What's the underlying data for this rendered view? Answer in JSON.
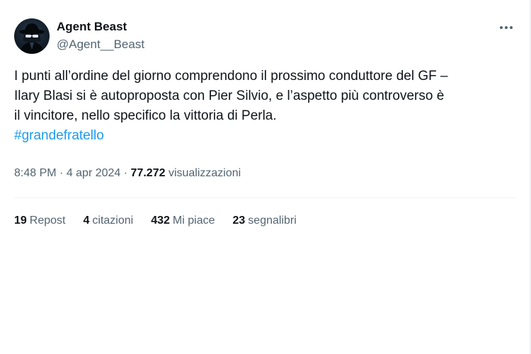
{
  "author": {
    "display_name": "Agent Beast",
    "handle": "@Agent__Beast",
    "avatar_icon": "hooded-agent-avatar"
  },
  "more_icon": "more-horizontal-icon",
  "tweet": {
    "lines": [
      "I punti all’ordine del giorno comprendono il prossimo conduttore del GF –",
      "Ilary Blasi si è autoproposta con Pier Silvio, e l’aspetto più controverso è",
      "il vincitore, nello specifico la vittoria di Perla."
    ],
    "hashtag": "#grandefratello"
  },
  "meta": {
    "time": "8:48 PM",
    "separator": " · ",
    "date": "4 apr 2024",
    "views_count": "77.272",
    "views_label": "visualizzazioni"
  },
  "stats": [
    {
      "count": "19",
      "label": "Repost"
    },
    {
      "count": "4",
      "label": "citazioni"
    },
    {
      "count": "432",
      "label": "Mi piace"
    },
    {
      "count": "23",
      "label": "segnalibri"
    }
  ],
  "colors": {
    "link": "#1d9bf0",
    "secondary_text": "#536471",
    "primary_text": "#0f1419",
    "divider": "#eff3f4"
  }
}
